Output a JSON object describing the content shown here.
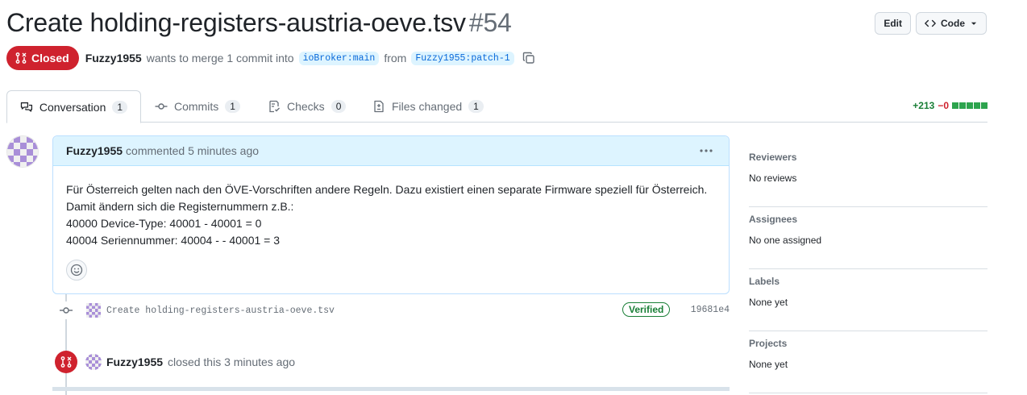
{
  "header": {
    "title": "Create holding-registers-austria-oeve.tsv",
    "number": "#54",
    "edit_label": "Edit",
    "code_label": "Code"
  },
  "meta": {
    "state": "Closed",
    "author": "Fuzzy1955",
    "text_1": "wants to merge 1 commit into",
    "base_branch": "ioBroker:main",
    "text_2": "from",
    "head_branch": "Fuzzy1955:patch-1"
  },
  "tabs": [
    {
      "label": "Conversation",
      "count": "1",
      "icon": "comment-discussion-icon"
    },
    {
      "label": "Commits",
      "count": "1",
      "icon": "git-commit-icon"
    },
    {
      "label": "Checks",
      "count": "0",
      "icon": "checklist-icon"
    },
    {
      "label": "Files changed",
      "count": "1",
      "icon": "file-diff-icon"
    }
  ],
  "diffstat": {
    "additions": "+213",
    "deletions": "−0"
  },
  "comment": {
    "author": "Fuzzy1955",
    "action": "commented 5 minutes ago",
    "body_lines": [
      "Für Österreich gelten nach den ÖVE-Vorschriften andere Regeln. Dazu existiert einen separate Firmware speziell für Österreich.",
      "Damit ändern sich die Registernummern z.B.:",
      "40000 Device-Type: 40001 - 40001 = 0",
      "40004 Seriennummer: 40004 - - 40001 = 3"
    ]
  },
  "commit": {
    "message": "Create holding-registers-austria-oeve.tsv",
    "verified_label": "Verified",
    "sha": "19681e4"
  },
  "closed_event": {
    "author": "Fuzzy1955",
    "text": "closed this 3 minutes ago"
  },
  "sidebar": [
    {
      "heading": "Reviewers",
      "value": "No reviews"
    },
    {
      "heading": "Assignees",
      "value": "No one assigned"
    },
    {
      "heading": "Labels",
      "value": "None yet"
    },
    {
      "heading": "Projects",
      "value": "None yet"
    }
  ],
  "colors": {
    "closed": "#cf222e",
    "accent": "#0969da",
    "success": "#1a7f37",
    "comment_header": "#ddf4ff"
  }
}
